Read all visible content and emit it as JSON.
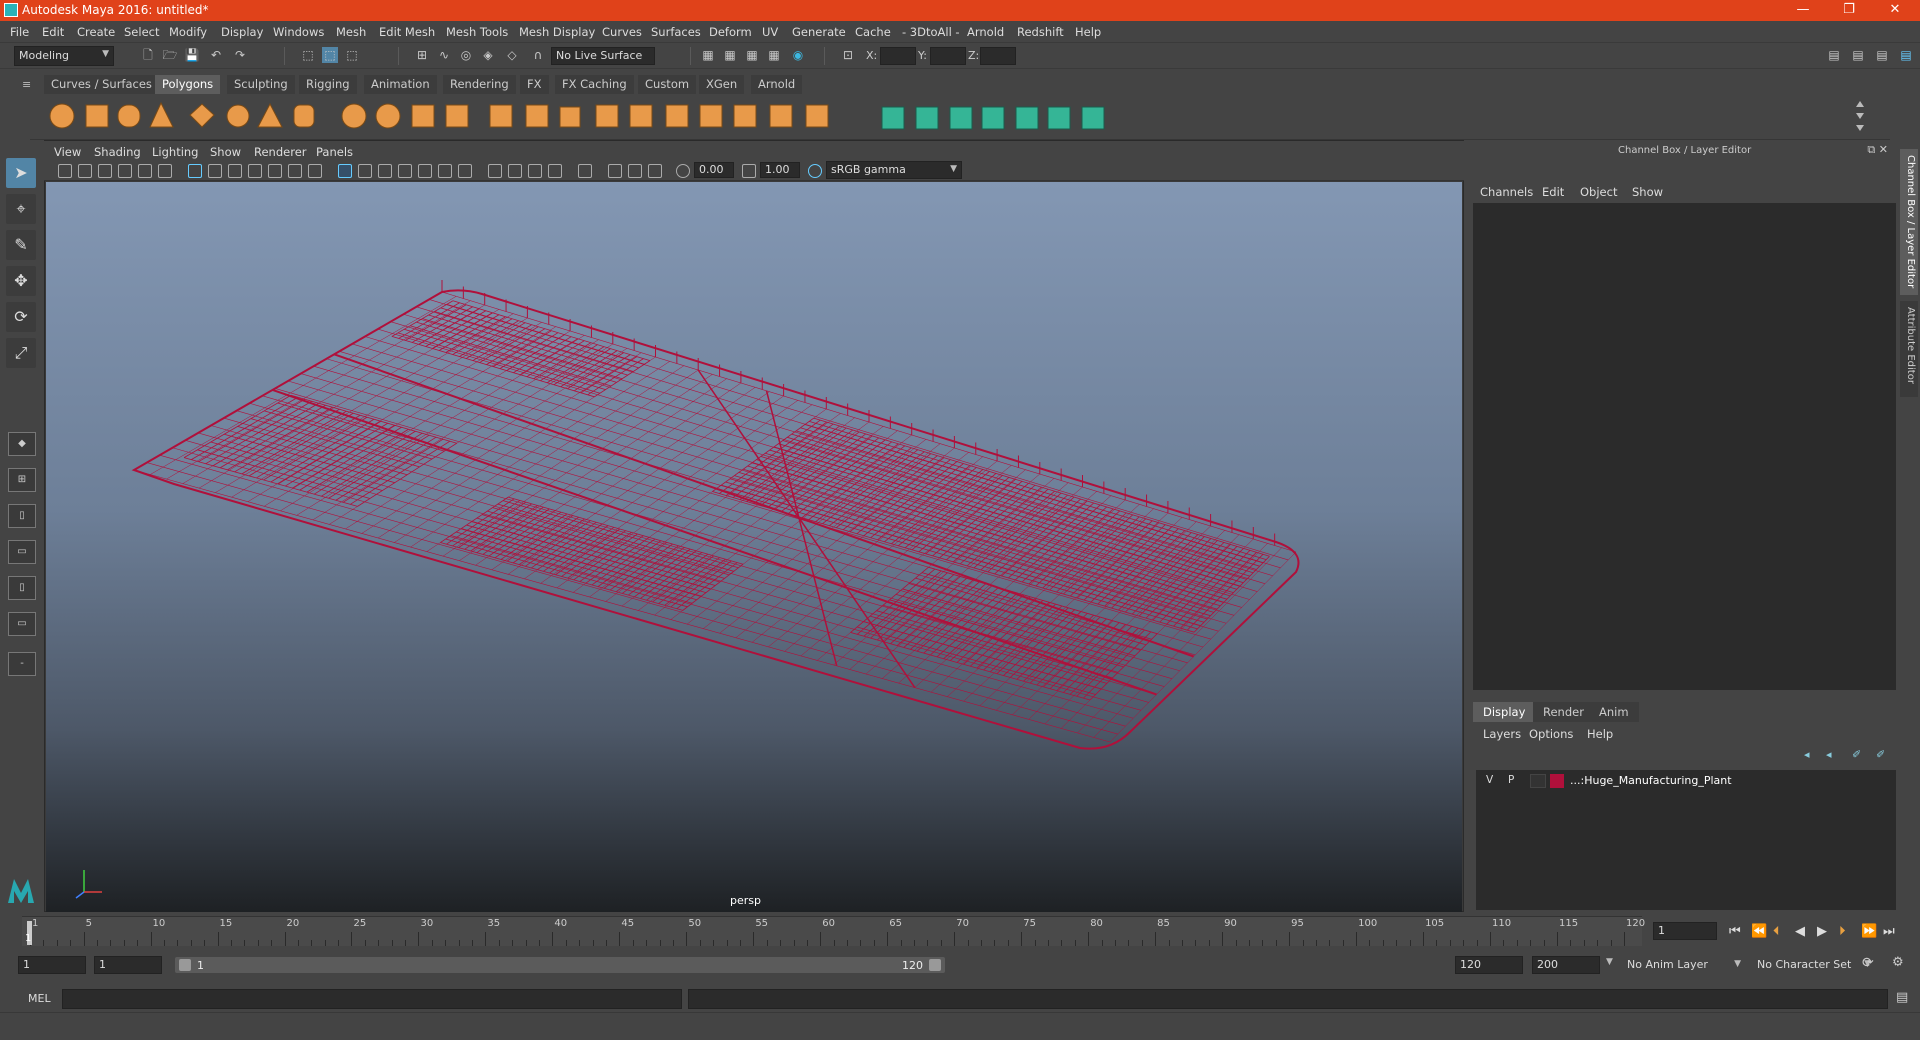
{
  "window": {
    "title": "Autodesk Maya 2016: untitled*",
    "minimize": "—",
    "restore": "❐",
    "close": "✕"
  },
  "menubar": [
    "File",
    "Edit",
    "Create",
    "Select",
    "Modify",
    "Display",
    "Windows",
    "Mesh",
    "Edit Mesh",
    "Mesh Tools",
    "Mesh Display",
    "Curves",
    "Surfaces",
    "Deform",
    "UV",
    "Generate",
    "Cache",
    "- 3DtoAll -",
    "Arnold",
    "Redshift",
    "Help"
  ],
  "statusline": {
    "mode": "Modeling",
    "live_surface": "No Live Surface",
    "x_label": "X:",
    "y_label": "Y:",
    "z_label": "Z:"
  },
  "shelf_tabs": [
    {
      "label": "Curves / Surfaces",
      "active": false
    },
    {
      "label": "Polygons",
      "active": true
    },
    {
      "label": "Sculpting",
      "active": false
    },
    {
      "label": "Rigging",
      "active": false
    },
    {
      "label": "Animation",
      "active": false
    },
    {
      "label": "Rendering",
      "active": false
    },
    {
      "label": "FX",
      "active": false
    },
    {
      "label": "FX Caching",
      "active": false
    },
    {
      "label": "Custom",
      "active": false
    },
    {
      "label": "XGen",
      "active": false
    },
    {
      "label": "Arnold",
      "active": false
    }
  ],
  "viewport": {
    "menu": [
      "View",
      "Shading",
      "Lighting",
      "Show",
      "Renderer",
      "Panels"
    ],
    "exposure": "0.00",
    "gamma": "1.00",
    "color_space": "sRGB gamma",
    "camera": "persp",
    "wire_color": "#b0103b"
  },
  "channel_box": {
    "title": "Channel Box / Layer Editor",
    "menu": [
      "Channels",
      "Edit",
      "Object",
      "Show"
    ]
  },
  "side_tabs": [
    "Channel Box / Layer Editor",
    "Attribute Editor"
  ],
  "layer_editor": {
    "tabs": [
      {
        "label": "Display",
        "active": true
      },
      {
        "label": "Render",
        "active": false
      },
      {
        "label": "Anim",
        "active": false
      }
    ],
    "menu": [
      "Layers",
      "Options",
      "Help"
    ],
    "layer": {
      "visible": "V",
      "playback": "P",
      "name": "...:Huge_Manufacturing_Plant",
      "color": "#b0103b"
    }
  },
  "timeline": {
    "ticks": [
      "1",
      "5",
      "10",
      "15",
      "20",
      "25",
      "30",
      "35",
      "40",
      "45",
      "50",
      "55",
      "60",
      "65",
      "70",
      "75",
      "80",
      "85",
      "90",
      "95",
      "100",
      "105",
      "110",
      "115",
      "120"
    ],
    "current_frame": "1",
    "marker": "1"
  },
  "range": {
    "start": "1",
    "playback_start": "1",
    "slider_start": "1",
    "slider_end": "120",
    "playback_end": "120",
    "end": "200",
    "anim_layer": "No Anim Layer",
    "character_set": "No Character Set"
  },
  "command_line": {
    "label": "MEL"
  }
}
